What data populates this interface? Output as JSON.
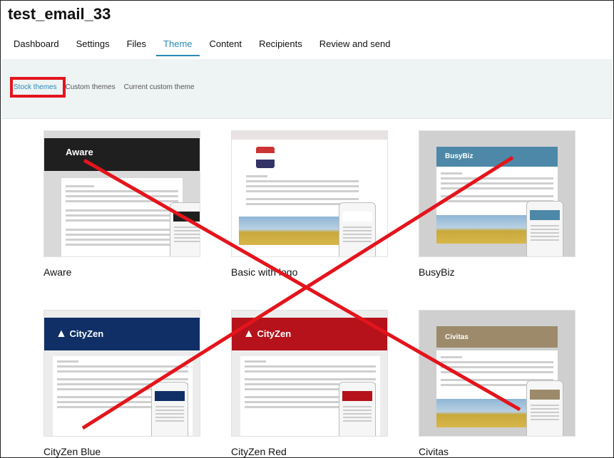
{
  "app": {
    "title": "test_email_33"
  },
  "nav": {
    "tabs": [
      {
        "label": "Dashboard"
      },
      {
        "label": "Settings"
      },
      {
        "label": "Files"
      },
      {
        "label": "Theme"
      },
      {
        "label": "Content"
      },
      {
        "label": "Recipients"
      },
      {
        "label": "Review and send"
      }
    ],
    "active": "Theme"
  },
  "subtabs": {
    "items": [
      {
        "label": "Stock themes"
      },
      {
        "label": "Custom themes"
      },
      {
        "label": "Current custom theme"
      }
    ],
    "active": "Stock themes"
  },
  "themes": [
    {
      "name": "Aware",
      "header": "Aware",
      "header_color": "#1f1f1f"
    },
    {
      "name": "Basic with logo",
      "header": "",
      "header_color": "#ffffff"
    },
    {
      "name": "BusyBiz",
      "header": "BusyBiz",
      "header_color": "#4d88a8"
    },
    {
      "name": "CityZen Blue",
      "header": "CityZen",
      "header_color": "#0f2f66"
    },
    {
      "name": "CityZen Red",
      "header": "CityZen",
      "header_color": "#b5121b"
    },
    {
      "name": "Civitas",
      "header": "Civitas",
      "header_color": "#9c8a6a"
    }
  ],
  "colors": {
    "accent": "#2a8bb5",
    "annotation_red": "#e4141c"
  }
}
